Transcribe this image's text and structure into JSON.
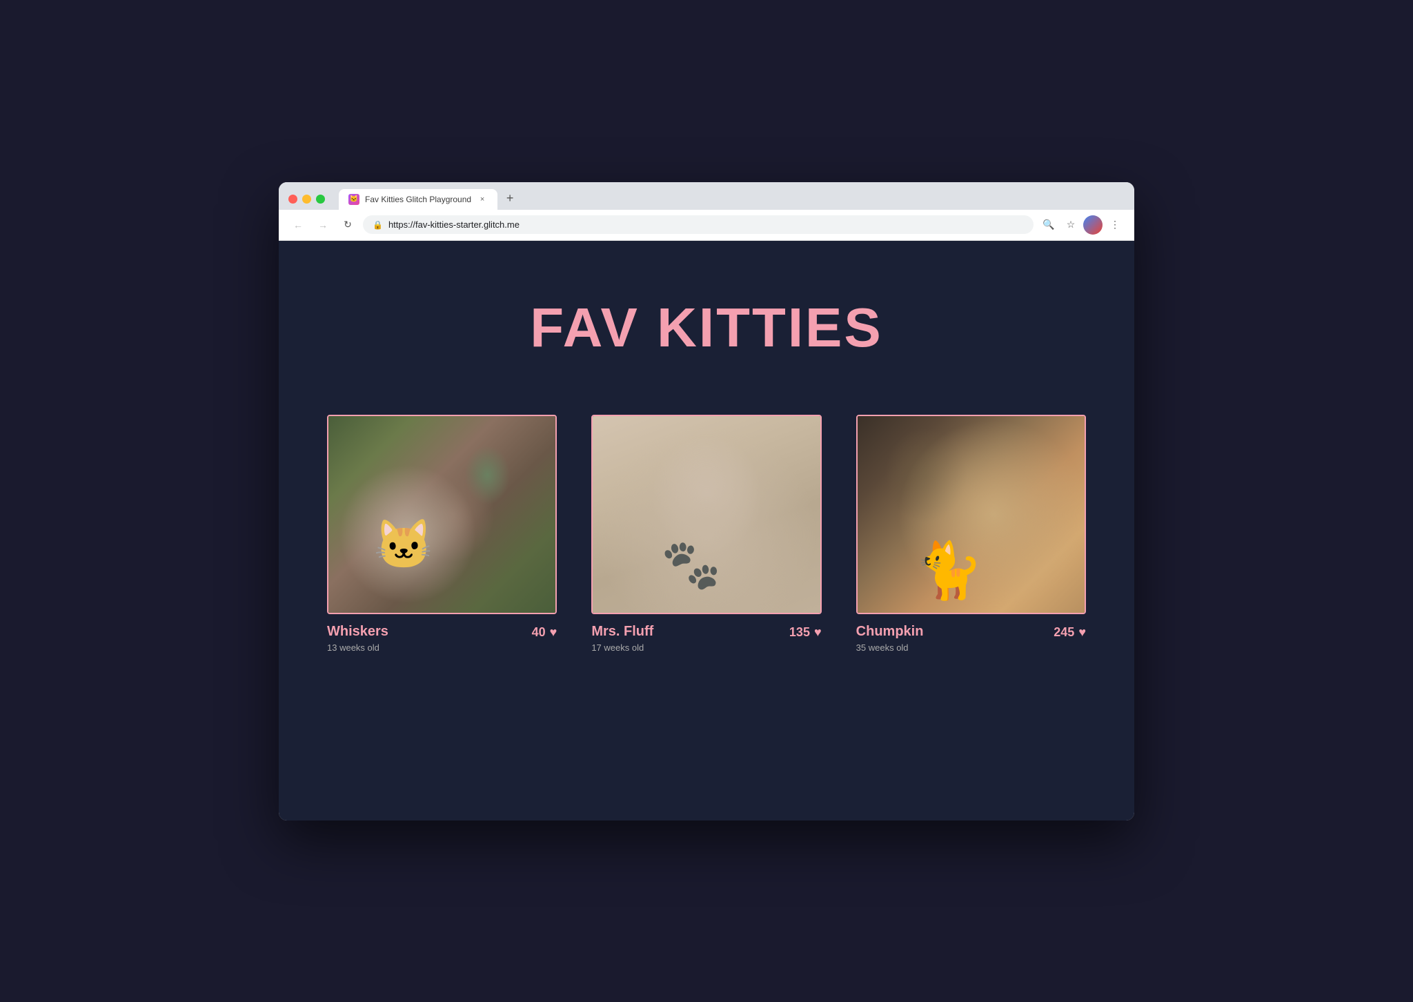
{
  "browser": {
    "tab": {
      "title": "Fav Kitties Glitch Playground",
      "close_label": "×",
      "new_tab_label": "+"
    },
    "nav": {
      "back_label": "←",
      "forward_label": "→",
      "reload_label": "↻",
      "url": "https://fav-kitties-starter.glitch.me"
    },
    "toolbar": {
      "search_label": "🔍",
      "star_label": "☆",
      "menu_label": "⋮"
    }
  },
  "page": {
    "title": "FAV KITTIES",
    "kitties": [
      {
        "id": "whiskers",
        "name": "Whiskers",
        "age": "13 weeks old",
        "votes": "40",
        "image_type": "cat1"
      },
      {
        "id": "mrs-fluff",
        "name": "Mrs. Fluff",
        "age": "17 weeks old",
        "votes": "135",
        "image_type": "cat2"
      },
      {
        "id": "chumpkin",
        "name": "Chumpkin",
        "age": "35 weeks old",
        "votes": "245",
        "image_type": "cat3"
      }
    ]
  }
}
